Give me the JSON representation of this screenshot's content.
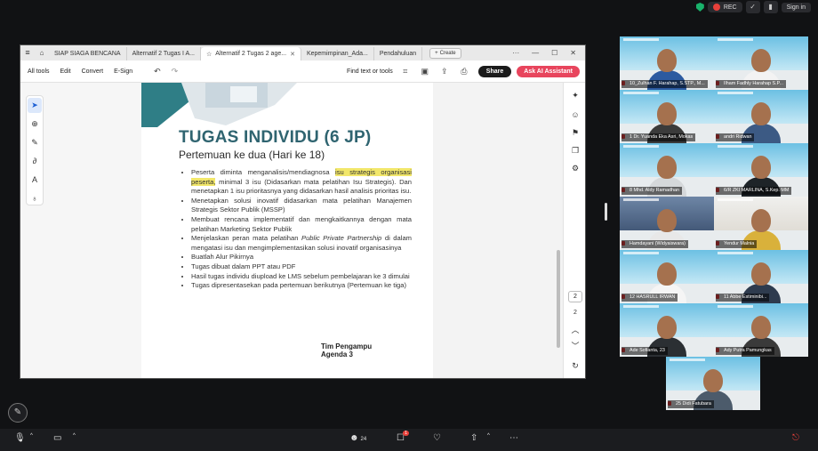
{
  "meeting": {
    "rec_label": "REC",
    "sign_in_label": "Sign in"
  },
  "acrobat": {
    "tabs": [
      {
        "label": "SIAP SIAGA BENCANA",
        "active": false
      },
      {
        "label": "Alternatif 2 Tugas I A...",
        "active": false
      },
      {
        "label": "Alternatif 2 Tugas 2 age...",
        "active": true
      },
      {
        "label": "Kepemimpinan_Ada...",
        "active": false
      },
      {
        "label": "Pendahuluan",
        "active": false
      }
    ],
    "create_label": "Create",
    "menu": [
      "All tools",
      "Edit",
      "Convert",
      "E-Sign"
    ],
    "find_label": "Find text or tools",
    "share_label": "Share",
    "ai_label": "Ask AI Assistant",
    "page_current": "2",
    "page_total": "2"
  },
  "slide": {
    "title": "TUGAS INDIVIDU (6 JP)",
    "subtitle": "Pertemuan ke dua (Hari ke 18)",
    "bullets": [
      {
        "pre": "Peserta diminta menganalisis/mendiagnosa ",
        "highlight": "isu strategis organisasi peserta,",
        "post": " minimal 3 isu (Didasarkan mata pelatihan Isu Strategis). Dan menetapkan 1 isu prioritasnya yang didasarkan hasil analisis prioritas isu."
      },
      {
        "pre": "Menetapkan solusi inovatif didasarkan mata pelatihan Manajemen Strategis Sektor Publik (MSSP)",
        "highlight": "",
        "post": ""
      },
      {
        "pre": "Membuat rencana implementatif dan mengkaitkannya dengan mata pelatihan Marketing Sektor Publik",
        "highlight": "",
        "post": ""
      },
      {
        "pre": "Menjelaskan peran mata pelatihan ",
        "italic": "Public Private Partnership",
        "post": " di dalam mengatasi isu dan mengimplementasikan solusi inovatif organisasinya"
      },
      {
        "pre": "Buatlah Alur Pikirnya",
        "highlight": "",
        "post": ""
      },
      {
        "pre": "Tugas dibuat dalam PPT atau PDF",
        "highlight": "",
        "post": ""
      },
      {
        "pre": "Hasil tugas individu diupload ke LMS sebelum pembelajaran ke 3 dimulai",
        "highlight": "",
        "post": ""
      },
      {
        "pre": "Tugas dipresentasekan pada pertemuan berikutnya (Pertemuan ke tiga)",
        "highlight": "",
        "post": ""
      }
    ],
    "footer_line1": "Tim Pengampu",
    "footer_line2": "Agenda 3"
  },
  "participants": [
    {
      "name": "10_Zulhan F. Harahap, S.STP., M..."
    },
    {
      "name": "Ilham Fadhly Harahap S.P..."
    },
    {
      "name": "1 Dr. Yuanda Eka Asri, Mokas"
    },
    {
      "name": "andri Ridwan"
    },
    {
      "name": "8 Mhd. Aldy Ramadhan"
    },
    {
      "name": "6/R ZKI MARLINA, S.Kep. MM"
    },
    {
      "name": "Hamdayani (Widyaiswara)"
    },
    {
      "name": "Yendur Malnia"
    },
    {
      "name": "12 HASRULL IRWAN"
    },
    {
      "name": "11 Abbe Estiminibi..."
    },
    {
      "name": "Ade Sofianta, 23"
    },
    {
      "name": "Ady Putra Pamungkas"
    },
    {
      "name": "25 Didi Fatubara"
    }
  ],
  "toolbar": {
    "participants_count": "24",
    "chat_badge": "1"
  },
  "colors": {
    "title_teal": "#2f6470",
    "highlight": "#f2e76a",
    "ai_button": "#e8455d"
  }
}
